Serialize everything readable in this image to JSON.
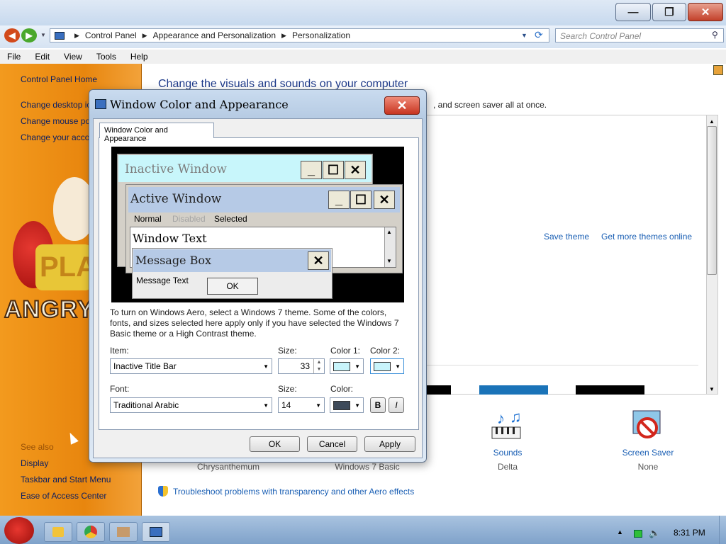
{
  "window": {
    "minimize": "—",
    "maximize": "❐",
    "close": "✕"
  },
  "address": {
    "crumbs": [
      "Control Panel",
      "Appearance and Personalization",
      "Personalization"
    ],
    "search_placeholder": "Search Control Panel"
  },
  "menu": [
    "File",
    "Edit",
    "View",
    "Tools",
    "Help"
  ],
  "sidebar": {
    "home": "Control Panel Home",
    "links": [
      "Change desktop ic",
      "Change mouse po",
      "Change your acco"
    ],
    "see_also": "See also",
    "bottom": [
      "Display",
      "Taskbar and Start Menu",
      "Ease of Access Center"
    ],
    "badge": "PLA",
    "brand": "ANGRY B"
  },
  "content": {
    "title": "Change the visuals and sounds on your computer",
    "subtitle": ", and screen saver all at once.",
    "save_theme": "Save theme",
    "more_themes": "Get more themes online",
    "items": [
      {
        "label": "Chrysanthemum"
      },
      {
        "label": "Windows 7 Basic"
      },
      {
        "label": "Sounds",
        "sub": "Delta"
      },
      {
        "label": "Screen Saver",
        "sub": "None"
      }
    ],
    "troubleshoot": "Troubleshoot problems with transparency and other Aero effects"
  },
  "dialog": {
    "title": "Window Color and Appearance",
    "tab": "Window Color and Appearance",
    "preview": {
      "inactive": "Inactive Window",
      "active": "Active Window",
      "menu": [
        "Normal",
        "Disabled",
        "Selected"
      ],
      "window_text": "Window Text",
      "message_box": "Message Box",
      "message_text": "Message Text",
      "ok": "OK"
    },
    "explanation": "To turn on Windows Aero, select a Windows 7 theme.  Some of the colors, fonts, and sizes selected here apply only if you have selected the Windows 7 Basic theme or a High Contrast theme.",
    "item_label": "Item:",
    "item_value": "Inactive Title Bar",
    "size_label": "Size:",
    "size_value": "33",
    "color1_label": "Color 1:",
    "color2_label": "Color 2:",
    "font_label": "Font:",
    "font_value": "Traditional Arabic",
    "font_size_label": "Size:",
    "font_size_value": "14",
    "color_label": "Color:",
    "bold": "B",
    "italic": "I",
    "ok": "OK",
    "cancel": "Cancel",
    "apply": "Apply"
  },
  "colors": {
    "color1": "#c8f4fb",
    "color2": "#c8f4fb",
    "font_color": "#3d4a5a",
    "inactive_bar": "#c8f6fb",
    "active_bar": "#b6cae6"
  },
  "taskbar": {
    "clock": "8:31 PM"
  }
}
